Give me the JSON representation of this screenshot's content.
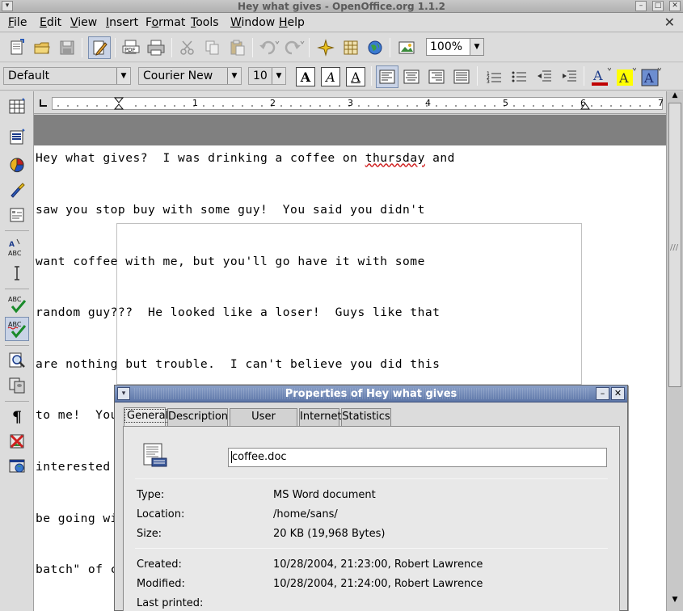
{
  "window": {
    "title": "Hey what gives - OpenOffice.org 1.1.2"
  },
  "menubar": {
    "items": [
      "File",
      "Edit",
      "View",
      "Insert",
      "Format",
      "Tools",
      "Window",
      "Help"
    ],
    "mnemonics": [
      "F",
      "E",
      "V",
      "I",
      "o",
      "T",
      "W",
      "H"
    ]
  },
  "toolbar": {
    "zoom": "100%"
  },
  "format": {
    "paragraph_style": "Default",
    "font_name": "Courier New",
    "font_size": "10",
    "font_color": "#c00000",
    "highlight_color": "#ffff00"
  },
  "ruler": {
    "numbers": [
      "1",
      "2",
      "3",
      "4",
      "5",
      "6",
      "7"
    ]
  },
  "document": {
    "lines": [
      "Hey what gives?  I was drinking a coffee on thursday and",
      "saw you stop buy with some guy!  You said you didn't",
      "want coffee with me, but you'll go have it with some",
      "random guy???  He looked like a loser!  Guys like that",
      "are nothing but trouble.  I can't believe you did this",
      "to me!  You should stick to your word, if you're not",
      "interested in going to coffee with me then you shouldn't",
      "be going with anyone!  I heard rumors about a \"bad",
      "batch\" of coffee, hope you don't get any..."
    ],
    "misspelled_word": "thursday"
  },
  "dialog": {
    "title": "Properties of Hey what gives",
    "tabs": [
      "General",
      "Description",
      "User Defined",
      "Internet",
      "Statistics"
    ],
    "active_tab": "General",
    "filename": "coffee.doc",
    "type_label": "Type:",
    "type_value": "MS Word document",
    "location_label": "Location:",
    "location_value": "/home/sans/",
    "size_label": "Size:",
    "size_value": "20 KB (19,968 Bytes)",
    "created_label": "Created:",
    "created_value": "10/28/2004, 21:23:00, Robert Lawrence",
    "modified_label": "Modified:",
    "modified_value": "10/28/2004, 21:24:00, Robert Lawrence",
    "printed_label": "Last printed:",
    "printed_value": ""
  }
}
